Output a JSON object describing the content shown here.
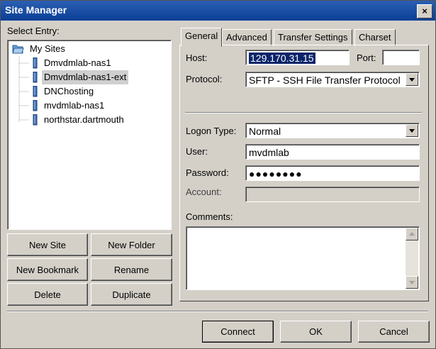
{
  "window": {
    "title": "Site Manager",
    "close_glyph": "×"
  },
  "left": {
    "select_entry_label": "Select Entry:",
    "tree": {
      "root": "My Sites",
      "items": [
        "Dmvdmlab-nas1",
        "Dmvdmlab-nas1-ext",
        "DNChosting",
        "mvdmlab-nas1",
        "northstar.dartmouth"
      ],
      "selected_index": 1
    },
    "buttons": {
      "new_site": "New Site",
      "new_folder": "New Folder",
      "new_bookmark": "New Bookmark",
      "rename": "Rename",
      "delete": "Delete",
      "duplicate": "Duplicate"
    }
  },
  "tabs": [
    "General",
    "Advanced",
    "Transfer Settings",
    "Charset"
  ],
  "active_tab": "General",
  "general": {
    "host_label": "Host:",
    "host_value": "129.170.31.15",
    "port_label": "Port:",
    "port_value": "",
    "protocol_label": "Protocol:",
    "protocol_value": "SFTP - SSH File Transfer Protocol",
    "logon_type_label": "Logon Type:",
    "logon_type_value": "Normal",
    "user_label": "User:",
    "user_value": "mvdmlab",
    "password_label": "Password:",
    "password_value": "●●●●●●●●",
    "account_label": "Account:",
    "account_value": "",
    "comments_label": "Comments:",
    "comments_value": ""
  },
  "footer": {
    "connect": "Connect",
    "ok": "OK",
    "cancel": "Cancel"
  },
  "colors": {
    "titlebar": "#0a3f96",
    "selection": "#0a246a",
    "face": "#d4d0c8"
  }
}
